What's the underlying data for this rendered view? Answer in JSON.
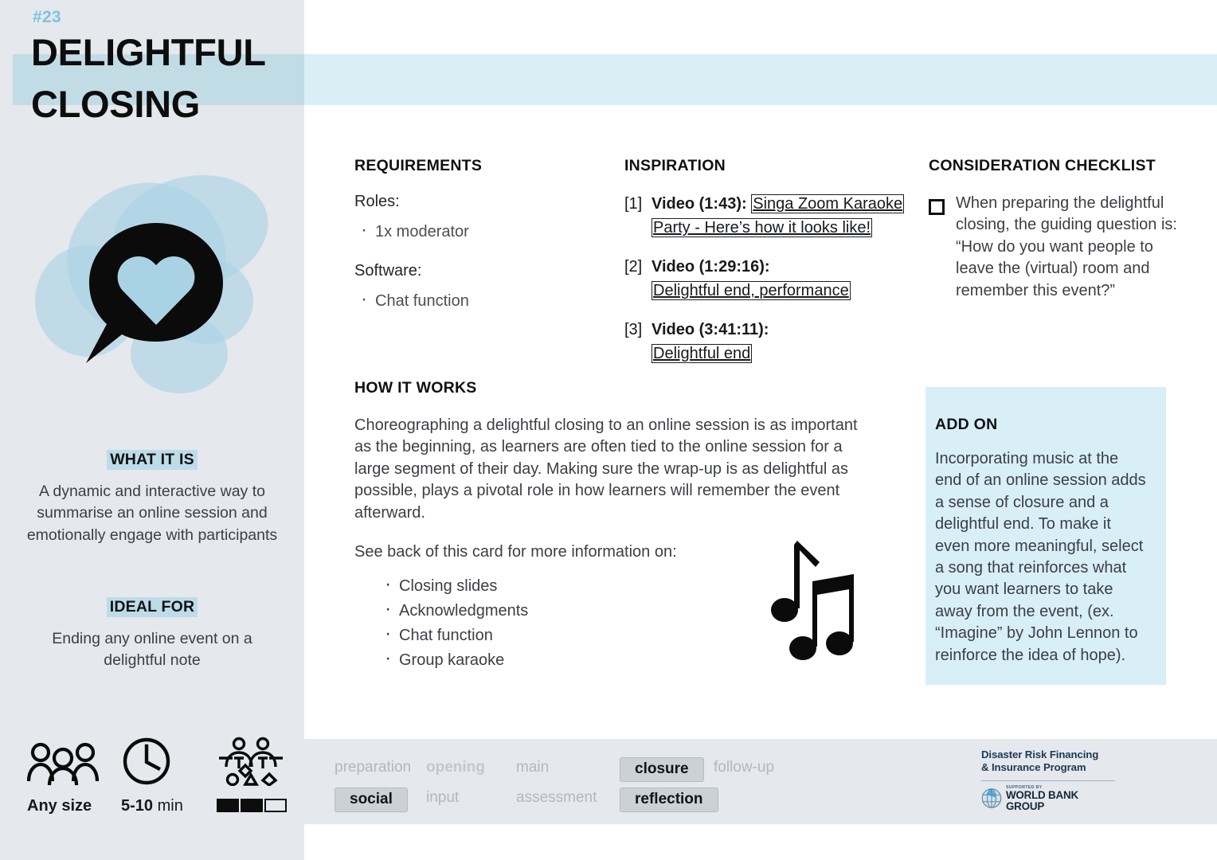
{
  "card": {
    "number": "#23",
    "title": "DELIGHTFUL CLOSING",
    "accent_blue": "#7fc2e0",
    "band_blue": "#daeef6",
    "sidebar_gray": "#e5e8ec",
    "addon_blue": "#d8eff8"
  },
  "hero": {
    "icon": "speech-bubble-heart-icon"
  },
  "sidebar": {
    "what_it_is": {
      "heading": "WHAT IT IS",
      "body": "A dynamic and interactive way to summarise an online session and emotionally engage with participants"
    },
    "ideal_for": {
      "heading": "IDEAL FOR",
      "body": "Ending any online event on a delightful note"
    },
    "meta": [
      {
        "icon": "group-people-icon",
        "label_bold": "Any size",
        "label_light": ""
      },
      {
        "icon": "clock-icon",
        "label_bold": "5-10",
        "label_light": " min"
      },
      {
        "icon": "interaction-shapes-icon",
        "label_bold": "",
        "label_light": "",
        "complexity_filled": 2,
        "complexity_total": 3
      }
    ]
  },
  "requirements": {
    "heading": "REQUIREMENTS",
    "roles_label": "Roles:",
    "roles": [
      "1x moderator"
    ],
    "software_label": "Software:",
    "software": [
      "Chat function"
    ]
  },
  "inspiration": {
    "heading": "INSPIRATION",
    "items": [
      {
        "index": "[1]",
        "label": "Video (1:43):",
        "link_line1": "Singa Zoom Karaoke",
        "link_line2": "Party - Here’s how it looks like!",
        "inline": true
      },
      {
        "index": "[2]",
        "label": "Video (1:29:16):",
        "link_line1": "Delightful end, performance",
        "link_line2": "",
        "inline": false
      },
      {
        "index": "[3]",
        "label": "Video (3:41:11):",
        "link_line1": "Delightful end",
        "link_line2": "",
        "inline": false
      }
    ]
  },
  "checklist": {
    "heading": "CONSIDERATION CHECKLIST",
    "items": [
      "When preparing the delightful closing, the guiding question is: “How do you want people to leave the (virtual) room and remember this event?”"
    ]
  },
  "how_it_works": {
    "heading": "HOW IT WORKS",
    "paragraph_1": "Choreographing a delightful closing to an online session is as important as the beginning, as learners are often tied to the online session for a large segment of their day. Making sure the wrap-up is as delightful as possible, plays a pivotal role in how learners will remember the event afterward.",
    "paragraph_2": "See back of this card for more information on:",
    "bullets": [
      "Closing slides",
      "Acknowledgments",
      "Chat function",
      "Group karaoke"
    ],
    "illustration": "music-notes-icon"
  },
  "add_on": {
    "heading": "ADD ON",
    "body": "Incorporating music at the end of an online session adds a sense of closure and a delightful end. To make it even more meaningful, select a song that reinforces what you want learners to take away from the event, (ex. “Imagine” by John Lennon to reinforce the idea of hope)."
  },
  "footer": {
    "tags_row_1": [
      {
        "label": "preparation",
        "state": "off"
      },
      {
        "label": "opening",
        "state": "bold-off"
      },
      {
        "label": "main",
        "state": "off"
      },
      {
        "label": "closure",
        "state": "on"
      },
      {
        "label": "follow-up",
        "state": "off"
      }
    ],
    "tags_row_2": [
      {
        "label": "social",
        "state": "on"
      },
      {
        "label": "input",
        "state": "off"
      },
      {
        "label": "assessment",
        "state": "off"
      },
      {
        "label": "reflection",
        "state": "on"
      },
      {
        "label": "",
        "state": "off"
      }
    ],
    "logo": {
      "program_line_1": "Disaster Risk Financing",
      "program_line_2": "& Insurance Program",
      "supported_by": "SUPPORTED BY",
      "org": "WORLD BANK GROUP",
      "icon": "globe-icon"
    }
  }
}
